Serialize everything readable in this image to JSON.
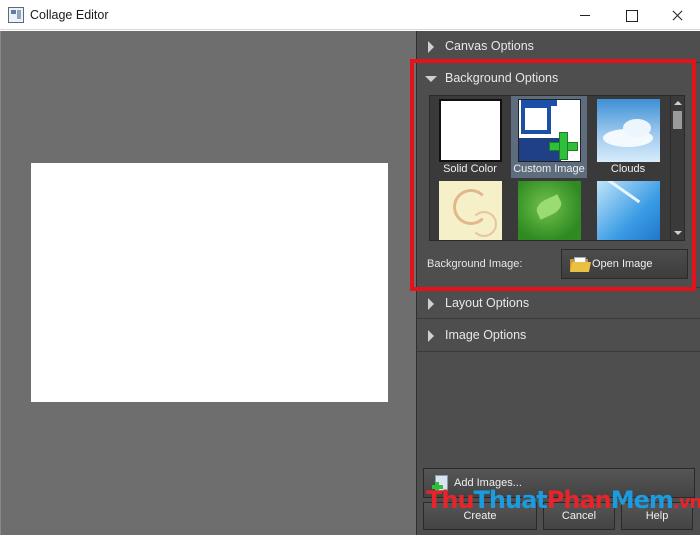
{
  "window": {
    "title": "Collage Editor"
  },
  "panel": {
    "sections": {
      "canvas": {
        "label": "Canvas Options",
        "expanded": false
      },
      "background": {
        "label": "Background Options",
        "expanded": true
      },
      "layout": {
        "label": "Layout Options",
        "expanded": false
      },
      "image": {
        "label": "Image Options",
        "expanded": false
      }
    },
    "background_thumbnails": [
      {
        "label": "Solid Color",
        "selected": false
      },
      {
        "label": "Custom Image",
        "selected": true
      },
      {
        "label": "Clouds",
        "selected": false
      },
      {
        "label": "",
        "selected": false
      },
      {
        "label": "",
        "selected": false
      },
      {
        "label": "",
        "selected": false
      }
    ],
    "background_image_label": "Background Image:",
    "open_image_label": "Open Image"
  },
  "actions": {
    "add_images": "Add Images...",
    "create": "Create",
    "cancel": "Cancel",
    "help": "Help"
  },
  "watermark": {
    "part1": "Thu",
    "part2": "Thuat",
    "part3": "Phan",
    "part4": "Mem",
    "part5": ".vn"
  },
  "colors": {
    "highlight": "#e3121b",
    "panel_bg": "#4e4e4e",
    "canvas_bg": "#6e6e6e",
    "selected_thumb": "#5d6d7e"
  }
}
